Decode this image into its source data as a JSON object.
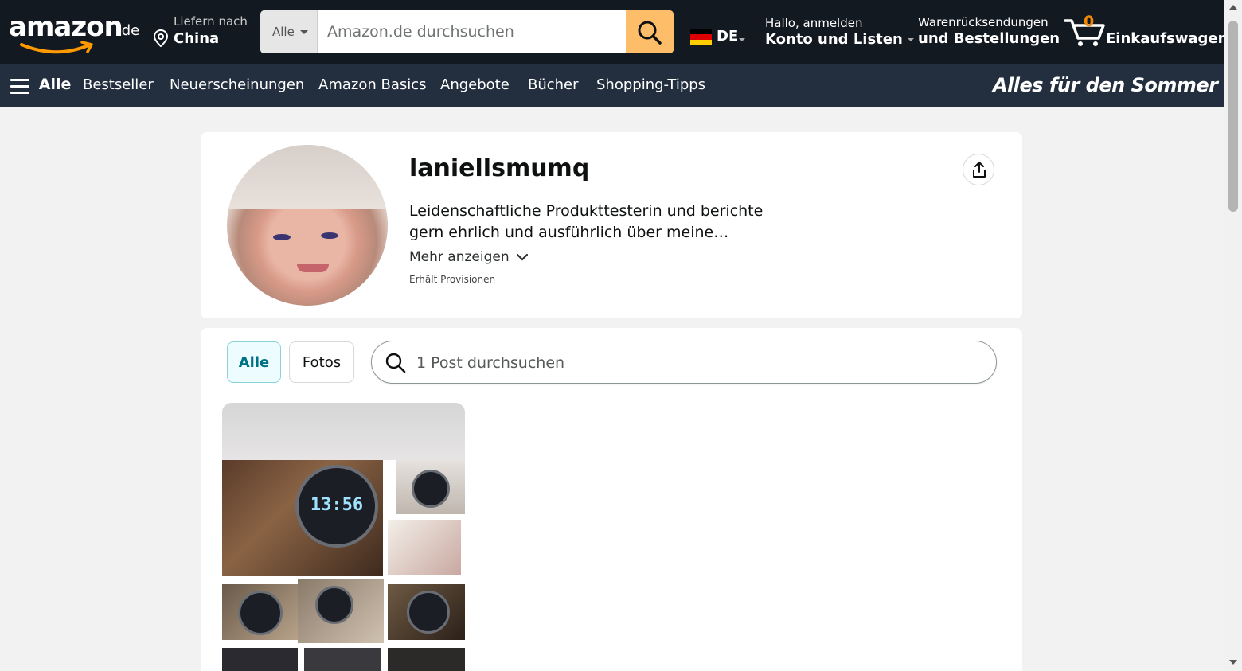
{
  "header": {
    "logo_text": "amazon",
    "logo_tld": ".de",
    "deliver_line1": "Liefern nach",
    "deliver_line2": "China",
    "search_category": "Alle",
    "search_placeholder": "Amazon.de durchsuchen",
    "language_code": "DE",
    "account_line1": "Hallo, anmelden",
    "account_line2": "Konto und Listen",
    "orders_line1": "Warenrücksendungen",
    "orders_line2": "und Bestellungen",
    "cart_count": "0",
    "cart_label": "Einkaufswagen"
  },
  "subnav": {
    "all_label": "Alle",
    "items": [
      "Bestseller",
      "Neuerscheinungen",
      "Amazon Basics",
      "Angebote",
      "Bücher",
      "Shopping-Tipps"
    ],
    "promo": "Alles für den Sommer"
  },
  "profile": {
    "name": "laniellsmumq",
    "bio": "Leidenschaftliche Produkttesterin und berichte gern ehrlich und ausführlich über meine…",
    "show_more": "Mehr anzeigen",
    "commission_note": "Erhält Provisionen"
  },
  "posts": {
    "filter_all": "Alle",
    "filter_photos": "Fotos",
    "search_placeholder": "1 Post durchsuchen",
    "watch_time": "13:56"
  },
  "colors": {
    "nav_dark": "#131921",
    "nav_sub": "#232f3e",
    "search_button": "#febd69",
    "cart_count": "#f08804",
    "chip_active_text": "#007185"
  },
  "icons": {
    "location": "location-pin-icon",
    "search": "magnifier-icon",
    "cart": "cart-icon",
    "share": "share-icon",
    "menu": "hamburger-icon",
    "chevron": "chevron-down-icon"
  }
}
